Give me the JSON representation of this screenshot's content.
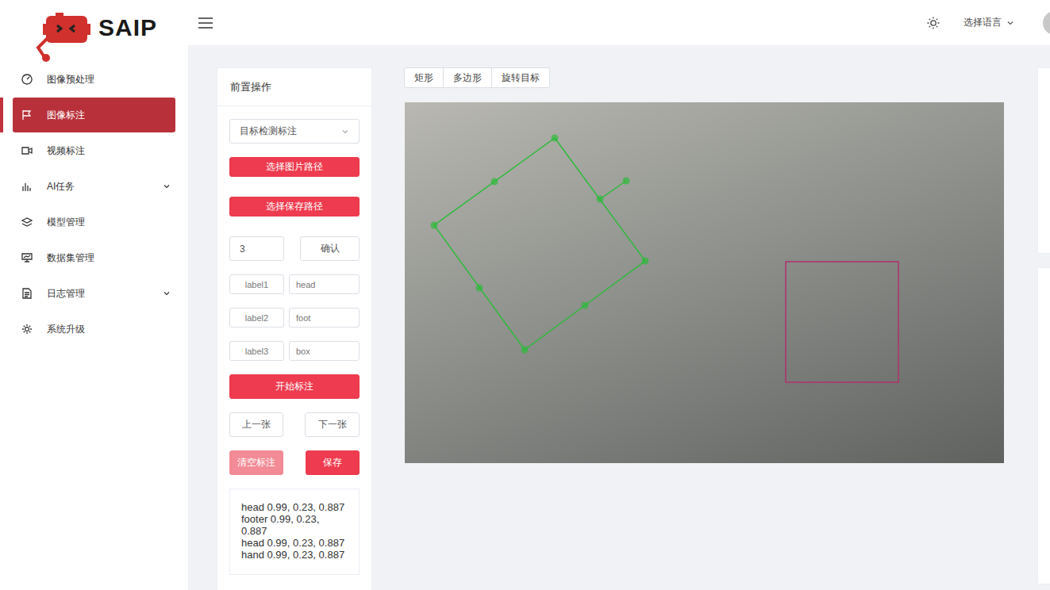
{
  "logo": {
    "text": "SAIP"
  },
  "sidebar": {
    "items": [
      {
        "label": "图像预处理",
        "selected": false,
        "expandable": false,
        "icon": "gauge"
      },
      {
        "label": "图像标注",
        "selected": true,
        "expandable": false,
        "icon": "flag"
      },
      {
        "label": "视频标注",
        "selected": false,
        "expandable": false,
        "icon": "video"
      },
      {
        "label": "AI任务",
        "selected": false,
        "expandable": true,
        "icon": "chart"
      },
      {
        "label": "模型管理",
        "selected": false,
        "expandable": false,
        "icon": "layers"
      },
      {
        "label": "数据集管理",
        "selected": false,
        "expandable": false,
        "icon": "dataset"
      },
      {
        "label": "日志管理",
        "selected": false,
        "expandable": true,
        "icon": "document"
      },
      {
        "label": "系统升级",
        "selected": false,
        "expandable": false,
        "icon": "gear"
      }
    ]
  },
  "header": {
    "language": "选择语言"
  },
  "panel": {
    "title": "前置操作",
    "mode_select": {
      "value": "目标检测标注"
    },
    "select_image_path": "选择图片路径",
    "select_save_path": "选择保存路径",
    "label_count": {
      "value": "3",
      "confirm": "确认"
    },
    "labels": [
      {
        "name": "label1",
        "value": "head"
      },
      {
        "name": "label2",
        "value": "foot"
      },
      {
        "name": "label3",
        "value": "box"
      }
    ],
    "start": "开始标注",
    "prev": "上一张",
    "next": "下一张",
    "clear": {
      "label": "清空标注",
      "disabled": true
    },
    "save": "保存",
    "results": [
      "head 0.99, 0.23, 0.887",
      "footer 0.99, 0.23, 0.887",
      "head 0.99, 0.23, 0.887",
      "hand 0.99, 0.23, 0.887"
    ]
  },
  "tools": [
    {
      "label": "矩形",
      "selected": false
    },
    {
      "label": "多边形",
      "selected": false
    },
    {
      "label": "旋转目标",
      "selected": false
    }
  ],
  "canvas": {
    "annotations": [
      {
        "kind": "polygon",
        "color": "#2dbb3a"
      },
      {
        "kind": "rect",
        "color": "#b0306e"
      }
    ]
  }
}
